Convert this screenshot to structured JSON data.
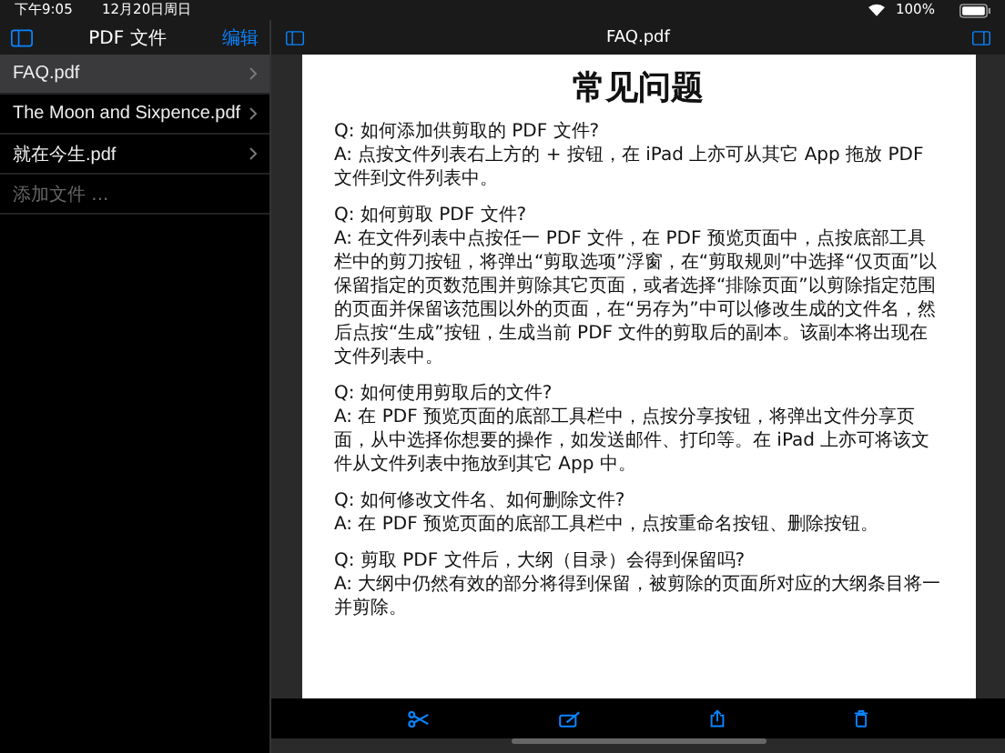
{
  "status_bar": {
    "time": "下午9:05",
    "date": "12月20日周日",
    "battery": "100%"
  },
  "sidebar": {
    "title": "PDF 文件",
    "edit": "编辑",
    "files": [
      {
        "name": "FAQ.pdf",
        "selected": true
      },
      {
        "name": "The Moon and Sixpence.pdf",
        "selected": false
      },
      {
        "name": "就在今生.pdf",
        "selected": false
      }
    ],
    "add_file": "添加文件 ..."
  },
  "viewer": {
    "title": "FAQ.pdf",
    "page_heading": "常见问题",
    "faq": [
      {
        "q": "Q: 如何添加供剪取的 PDF 文件?",
        "a": "A: 点按文件列表右上方的 + 按钮，在 iPad 上亦可从其它 App 拖放 PDF 文件到文件列表中。"
      },
      {
        "q": "Q: 如何剪取 PDF 文件?",
        "a": "A: 在文件列表中点按任一 PDF 文件，在 PDF 预览页面中，点按底部工具栏中的剪刀按钮，将弹出“剪取选项”浮窗，在“剪取规则”中选择“仅页面”以保留指定的页数范围并剪除其它页面，或者选择“排除页面”以剪除指定范围的页面并保留该范围以外的页面，在“另存为”中可以修改生成的文件名，然后点按“生成”按钮，生成当前 PDF 文件的剪取后的副本。该副本将出现在文件列表中。"
      },
      {
        "q": "Q: 如何使用剪取后的文件?",
        "a": "A: 在 PDF 预览页面的底部工具栏中，点按分享按钮，将弹出文件分享页面，从中选择你想要的操作，如发送邮件、打印等。在 iPad 上亦可将该文件从文件列表中拖放到其它 App 中。"
      },
      {
        "q": "Q: 如何修改文件名、如何删除文件?",
        "a": "A: 在 PDF 预览页面的底部工具栏中，点按重命名按钮、删除按钮。"
      },
      {
        "q": "Q: 剪取 PDF 文件后，大纲（目录）会得到保留吗?",
        "a": "A: 大纲中仍然有效的部分将得到保留，被剪除的页面所对应的大纲条目将一并剪除。"
      }
    ]
  }
}
